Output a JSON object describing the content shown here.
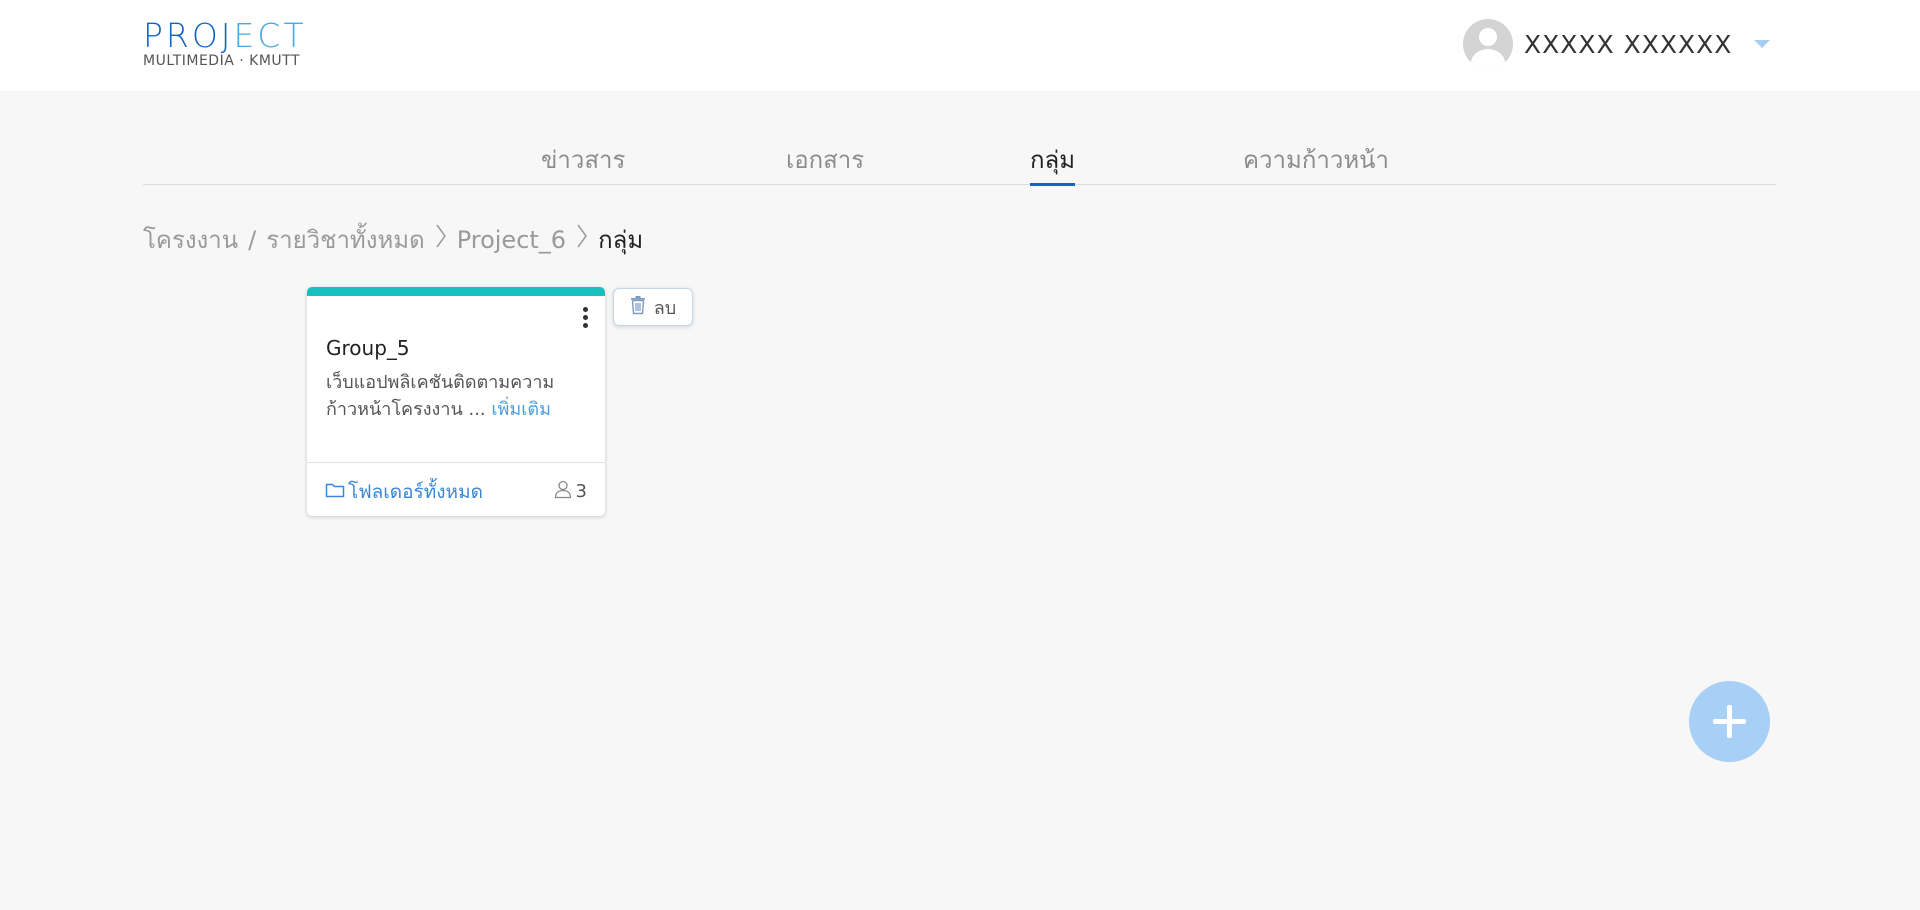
{
  "header": {
    "logo_main_dark": "PROJ",
    "logo_main_light": "ECT",
    "logo_sub": "MULTIMEDIA · KMUTT",
    "user_name": "XXXXX XXXXXX"
  },
  "tabs": [
    {
      "label": "ข่าวสาร",
      "active": false
    },
    {
      "label": "เอกสาร",
      "active": false
    },
    {
      "label": "กลุ่ม",
      "active": true
    },
    {
      "label": "ความก้าวหน้า",
      "active": false
    }
  ],
  "breadcrumb": {
    "root": "โครงงาน",
    "separator": "/",
    "level1": "รายวิชาทั้งหมด",
    "level2": "Project_6",
    "current": "กลุ่ม"
  },
  "group_card": {
    "accent_color": "#16c1bf",
    "title": "Group_5",
    "description": "เว็บแอปพลิเคชันติดตามความก้าวหน้าโครงงาน ...",
    "more_label": "เพิ่มเติม",
    "folder_label": "โฟลเดอร์ทั้งหมด",
    "member_count": "3"
  },
  "delete_popup": {
    "label": "ลบ"
  },
  "fab": {
    "icon": "plus-icon"
  }
}
